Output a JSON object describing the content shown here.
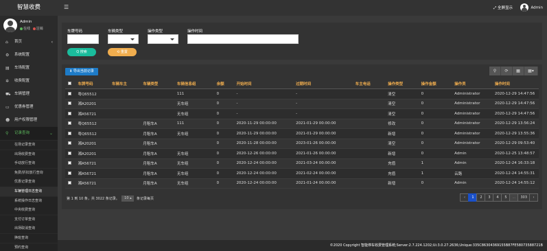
{
  "app": {
    "title": "智慧收费"
  },
  "user": {
    "name": "Admin",
    "online": "在线",
    "logout": "注销"
  },
  "topbar": {
    "fullscreen": "全屏显示",
    "user": "Admin"
  },
  "sidebar": {
    "items": [
      {
        "label": "首页",
        "icon": "home-icon",
        "glyph": "⌂",
        "arrow": "‹"
      },
      {
        "label": "系统配置",
        "icon": "gear-icon",
        "glyph": "⚙"
      },
      {
        "label": "车场配置",
        "icon": "document-icon",
        "glyph": "▤"
      },
      {
        "label": "收费配置",
        "icon": "settings-icon",
        "glyph": "✲"
      },
      {
        "label": "车辆管理",
        "icon": "car-icon",
        "glyph": "⛟"
      },
      {
        "label": "优惠券管理",
        "icon": "coupon-icon",
        "glyph": "▭"
      },
      {
        "label": "用户权限管理",
        "icon": "users-icon",
        "glyph": "☻"
      },
      {
        "label": "记录查询",
        "icon": "search-icon",
        "glyph": "⚲",
        "arrow": "⌄"
      }
    ],
    "subitems": [
      "在场记录查询",
      "出场收费查询",
      "手动放行查询",
      "免费/折扣放行查询",
      "优惠记录查询",
      "车辆管理日志查询",
      "系统操作日志查询",
      "中央收费查询",
      "支付订单查询",
      "出场取消查询",
      "换班查询",
      "预约查询"
    ]
  },
  "filters": {
    "plate_label": "车牌号码",
    "plate_value": "",
    "vtype_label": "车辆类型",
    "vtype_value": "",
    "optype_label": "操作类型",
    "optype_value": "",
    "optime_label": "操作时间",
    "optime_value": "",
    "search_btn": "Q 搜索",
    "reset_btn": "⟲ 重置"
  },
  "toolbar": {
    "export": "⬇ 导出当前记录",
    "search_icon": "⚲",
    "refresh_icon": "⟳",
    "columns_icon": "▦",
    "export_icon": "▦▾"
  },
  "table": {
    "columns": [
      "车牌号码",
      "车辆车主",
      "车辆类型",
      "车辆信息组",
      "余额",
      "开始时间",
      "过期时间",
      "车主电话",
      "操作类型",
      "操作金额",
      "操作员",
      "操作时间"
    ],
    "rows": [
      [
        "粤Q65512",
        "",
        "",
        "111",
        "0",
        "-",
        "-",
        "",
        "清空",
        "0",
        "Administrator",
        "2020-12-29 14:47:56"
      ],
      [
        "湘A20201",
        "",
        "",
        "无车组",
        "0",
        "-",
        "-",
        "",
        "清空",
        "0",
        "Administrator",
        "2020-12-29 14:47:56"
      ],
      [
        "湘A56721",
        "",
        "",
        "无车组",
        "0",
        "-",
        "-",
        "",
        "清空",
        "0",
        "Administrator",
        "2020-12-29 14:47:56"
      ],
      [
        "粤Q65512",
        "",
        "月租车A",
        "111",
        "0",
        "2020-11-29 00:00:00",
        "2021-01-29 00:00:00",
        "",
        "修改",
        "0",
        "Administrator",
        "2020-12-29 13:56:24"
      ],
      [
        "粤Q65512",
        "",
        "月租车A",
        "无车组",
        "0",
        "2020-11-29 00:00:00",
        "2021-01-29 00:00:00",
        "",
        "新增",
        "0",
        "Administrator",
        "2020-12-29 13:55:36"
      ],
      [
        "湘A20201",
        "",
        "月租车A",
        "",
        "0",
        "2020-11-28 00:00:00",
        "2023-01-26 00:00:00",
        "",
        "清空",
        "0",
        "Administrator",
        "2020-12-29 09:53:40"
      ],
      [
        "湘A20201",
        "",
        "月租车A",
        "无车组",
        "0",
        "2020-12-26 00:00:00",
        "2021-01-26 00:00:00",
        "",
        "新增",
        "0",
        "Admin",
        "2020-12-25 13:48:57"
      ],
      [
        "湘A56721",
        "",
        "月租车A",
        "无车组",
        "0",
        "2020-12-24 00:00:00",
        "2021-03-24 00:00:00",
        "",
        "充值",
        "1",
        "Admin",
        "2020-12-24 16:33:18"
      ],
      [
        "湘A56721",
        "",
        "月租车A",
        "无车组",
        "0",
        "2020-12-24 00:00:00",
        "2021-02-24 00:00:00",
        "",
        "充值",
        "1",
        "云路",
        "2020-12-24 14:55:31"
      ],
      [
        "湘A56721",
        "",
        "月租车A",
        "无车组",
        "0",
        "2020-12-24 00:00:00",
        "2021-01-24 00:00:00",
        "",
        "新增",
        "0",
        "Admin",
        "2020-12-24 14:55:12"
      ]
    ]
  },
  "pagination": {
    "info_prefix": "第 1 到 10 条，共 3022 条记录。",
    "page_size": "10 ▴",
    "info_suffix": "条记录每页",
    "pages": [
      "‹",
      "1",
      "2",
      "3",
      "4",
      "5",
      "...",
      "303",
      "›"
    ],
    "current": "1"
  },
  "footer": {
    "text": "©2020 Copyright   智能停车收费管理系统;Server:2.7.224.1202;Ui:3.0.27.2636;Unique:335C86304369155B87FE58073588721B"
  }
}
